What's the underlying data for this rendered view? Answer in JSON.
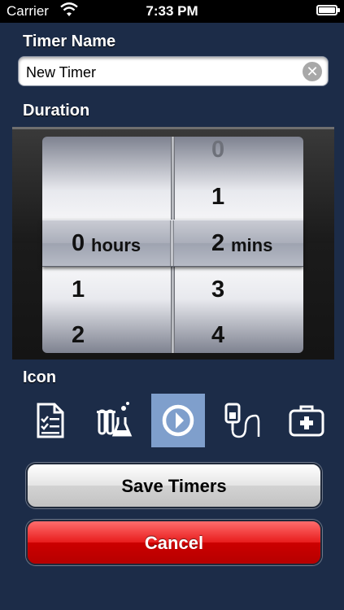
{
  "status_bar": {
    "carrier": "Carrier",
    "time": "7:33 PM"
  },
  "timer_name": {
    "label": "Timer Name",
    "value": "New Timer",
    "clear_icon": "clear-x-icon"
  },
  "duration": {
    "label": "Duration",
    "hours_column": {
      "above": [
        "",
        ""
      ],
      "selected": "0",
      "unit": "hours",
      "below": [
        "1",
        "2"
      ]
    },
    "mins_column": {
      "above": [
        "0",
        "1"
      ],
      "selected": "2",
      "unit": "mins",
      "below": [
        "3",
        "4"
      ]
    }
  },
  "icon_section": {
    "label": "Icon",
    "icons": [
      {
        "name": "document-checklist-icon",
        "selected": false
      },
      {
        "name": "lab-flask-icon",
        "selected": false
      },
      {
        "name": "clock-timer-icon",
        "selected": true
      },
      {
        "name": "iv-drip-icon",
        "selected": false
      },
      {
        "name": "first-aid-kit-icon",
        "selected": false
      }
    ]
  },
  "buttons": {
    "save_label": "Save Timers",
    "cancel_label": "Cancel"
  },
  "colors": {
    "background": "#1c2c48",
    "selected_icon": "#7f9fcc",
    "cancel": "#dd1111"
  }
}
